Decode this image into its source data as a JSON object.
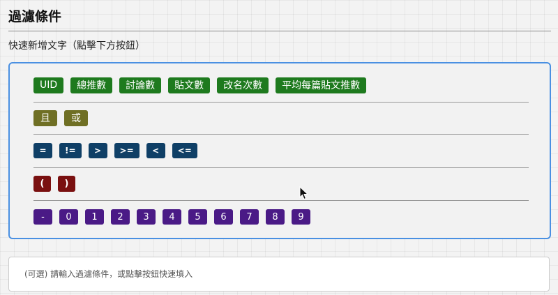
{
  "title": "過濾條件",
  "hint": "快速新增文字（點擊下方按鈕）",
  "colors": {
    "field": "#1e7a1e",
    "logic": "#6f6f24",
    "operator": "#0f3f66",
    "paren": "#7a1010",
    "number": "#4a1a86",
    "panel_border": "#4a90e2"
  },
  "fields": [
    "UID",
    "總推數",
    "討論數",
    "貼文數",
    "改名次數",
    "平均每篇貼文推數"
  ],
  "logic": [
    "且",
    "或"
  ],
  "operators": [
    "=",
    "!=",
    ">",
    ">=",
    "<",
    "<="
  ],
  "parens": [
    "(",
    ")"
  ],
  "numbers": [
    "-",
    "0",
    "1",
    "2",
    "3",
    "4",
    "5",
    "6",
    "7",
    "8",
    "9"
  ],
  "input": {
    "placeholder": "(可選) 請輸入過濾條件，或點擊按鈕快速填入",
    "value": ""
  }
}
